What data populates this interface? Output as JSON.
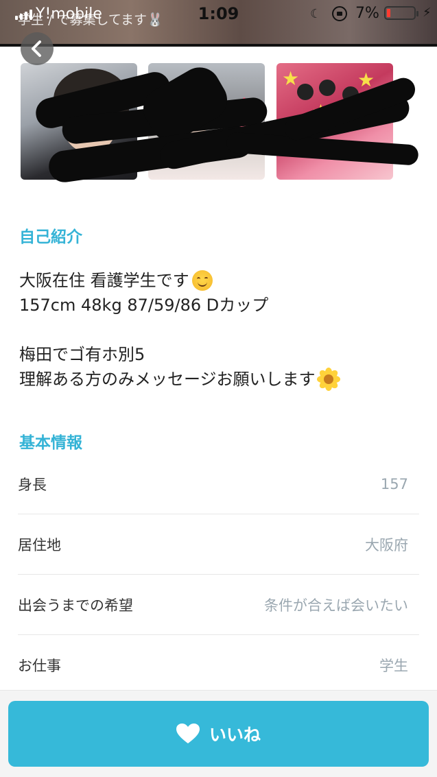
{
  "status_bar": {
    "carrier": "Y!mobile",
    "overlay_text": "学生 / で募集してます🐰",
    "time": "1:09",
    "battery_percent": "7%",
    "battery_level": 0.07,
    "battery_color": "#ff3b30"
  },
  "nav": {
    "back_icon": "chevron-left-icon"
  },
  "photos": [
    {
      "name": "profile-photo-1"
    },
    {
      "name": "profile-photo-2"
    },
    {
      "name": "profile-photo-3"
    }
  ],
  "self_intro": {
    "title": "自己紹介",
    "lines": [
      "大阪在住 看護学生です",
      "157cm 48kg 87/59/86 Dカップ",
      "梅田でゴ有ホ別5",
      "理解ある方のみメッセージお願いします"
    ],
    "emojis": [
      "smiling-face-icon",
      "sunflower-icon"
    ]
  },
  "basic_info": {
    "title": "基本情報",
    "rows": [
      {
        "label": "身長",
        "value": "157"
      },
      {
        "label": "居住地",
        "value": "大阪府"
      },
      {
        "label": "出会うまでの希望",
        "value": "条件が合えば会いたい"
      },
      {
        "label": "お仕事",
        "value": "学生"
      }
    ]
  },
  "like_button": {
    "label": "いいね",
    "icon": "heart-icon",
    "color": "#36b9d9"
  },
  "colors": {
    "accent": "#34b3d6",
    "value_text": "#9aa7b0"
  }
}
